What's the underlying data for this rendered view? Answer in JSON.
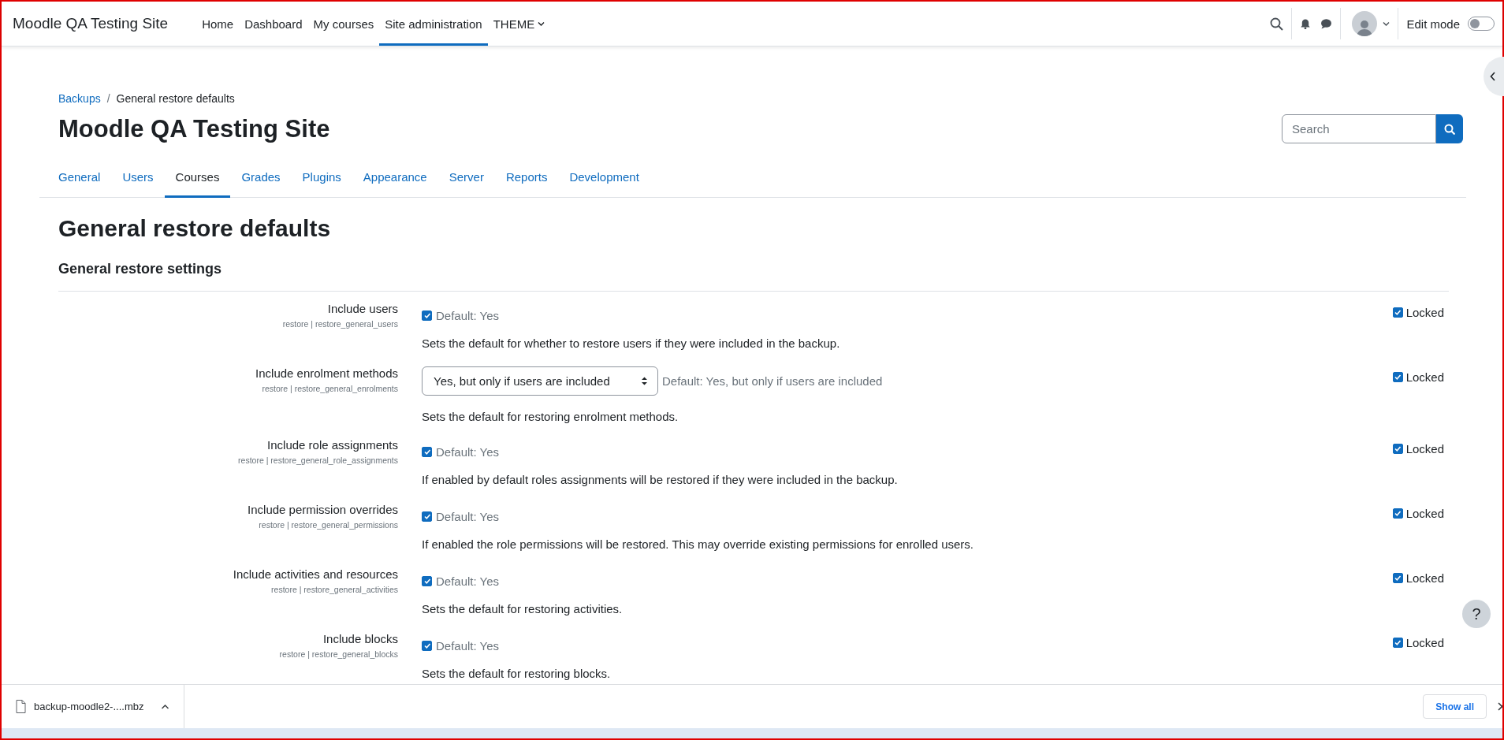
{
  "navbar": {
    "site_name": "Moodle QA Testing Site",
    "items": [
      {
        "label": "Home",
        "kind": "link",
        "selected": false
      },
      {
        "label": "Dashboard",
        "kind": "link",
        "selected": false
      },
      {
        "label": "My courses",
        "kind": "link",
        "selected": false
      },
      {
        "label": "Site administration",
        "kind": "link",
        "selected": true
      },
      {
        "label": "THEME",
        "kind": "dropdown",
        "selected": false
      }
    ],
    "edit_mode": {
      "label": "Edit mode",
      "on": false
    }
  },
  "breadcrumb_separator": "/",
  "breadcrumb": [
    {
      "label": "Backups",
      "kind": "link"
    },
    {
      "label": "General restore defaults",
      "kind": "current"
    }
  ],
  "page_title": "Moodle QA Testing Site",
  "search": {
    "placeholder": "Search"
  },
  "tabs": [
    {
      "label": "General",
      "selected": false
    },
    {
      "label": "Users",
      "selected": false
    },
    {
      "label": "Courses",
      "selected": true
    },
    {
      "label": "Grades",
      "selected": false
    },
    {
      "label": "Plugins",
      "selected": false
    },
    {
      "label": "Appearance",
      "selected": false
    },
    {
      "label": "Server",
      "selected": false
    },
    {
      "label": "Reports",
      "selected": false
    },
    {
      "label": "Development",
      "selected": false
    }
  ],
  "heading": "General restore defaults",
  "section_heading": "General restore settings",
  "settings": [
    {
      "label": "Include users",
      "setting_id": "restore | restore_general_users",
      "kind": "checkbox",
      "checked": true,
      "default": "Default: Yes",
      "description": "Sets the default for whether to restore users if they were included in the backup.",
      "locked_label": "Locked",
      "locked": true
    },
    {
      "label": "Include enrolment methods",
      "setting_id": "restore | restore_general_enrolments",
      "kind": "select",
      "value": "Yes, but only if users are included",
      "default": "Default: Yes, but only if users are included",
      "description": "Sets the default for restoring enrolment methods.",
      "locked_label": "Locked",
      "locked": true
    },
    {
      "label": "Include role assignments",
      "setting_id": "restore | restore_general_role_assignments",
      "kind": "checkbox",
      "checked": true,
      "default": "Default: Yes",
      "description": "If enabled by default roles assignments will be restored if they were included in the backup.",
      "locked_label": "Locked",
      "locked": true
    },
    {
      "label": "Include permission overrides",
      "setting_id": "restore | restore_general_permissions",
      "kind": "checkbox",
      "checked": true,
      "default": "Default: Yes",
      "description": "If enabled the role permissions will be restored. This may override existing permissions for enrolled users.",
      "locked_label": "Locked",
      "locked": true
    },
    {
      "label": "Include activities and resources",
      "setting_id": "restore | restore_general_activities",
      "kind": "checkbox",
      "checked": true,
      "default": "Default: Yes",
      "description": "Sets the default for restoring activities.",
      "locked_label": "Locked",
      "locked": true
    },
    {
      "label": "Include blocks",
      "setting_id": "restore | restore_general_blocks",
      "kind": "checkbox",
      "checked": true,
      "default": "Default: Yes",
      "description": "Sets the default for restoring blocks.",
      "locked_label": "Locked",
      "locked": true
    }
  ],
  "help_button": {
    "label": "?"
  },
  "download_bar": {
    "file": "backup-moodle2-....mbz",
    "show_all": "Show all"
  }
}
